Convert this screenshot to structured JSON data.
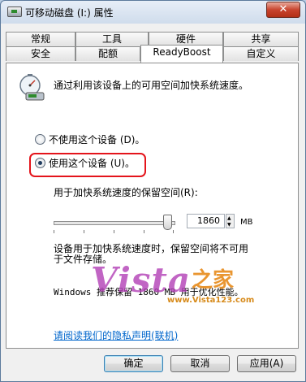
{
  "window": {
    "title": "可移动磁盘 (I:) 属性",
    "close_symbol": "✕"
  },
  "tabs": {
    "row1": [
      "常规",
      "工具",
      "硬件",
      "共享"
    ],
    "row2": [
      "安全",
      "配额",
      "ReadyBoost",
      "自定义"
    ],
    "active": "ReadyBoost"
  },
  "panel": {
    "icon": "usb-drive-speed-icon",
    "description": "通过利用该设备上的可用空间加快系统速度。",
    "options": [
      {
        "label": "不使用这个设备 (D)。",
        "selected": false
      },
      {
        "label": "使用这个设备 (U)。",
        "selected": true
      }
    ],
    "reserve_label": "用于加快系统速度的保留空间(R):",
    "reserve_value": "1860",
    "unit": "MB",
    "slider_fraction": 0.93,
    "info_line1": "设备用于加快系统速度时，保留空间将不可用",
    "info_line2": "于文件存储。",
    "recommend_text": "Windows 推荐保留 1860 MB 用于优化性能。",
    "privacy_link": "请阅读我们的隐私声明(联机)"
  },
  "watermark": {
    "main": "Vista",
    "cn": "之家",
    "url": "www.Vista123.com"
  },
  "buttons": {
    "ok": "确定",
    "cancel": "取消",
    "apply": "应用(A)"
  },
  "colors": {
    "highlight": "#e4141b",
    "link": "#0066cc",
    "watermark_main": "#b23fb6",
    "watermark_cn": "#e6840e"
  }
}
